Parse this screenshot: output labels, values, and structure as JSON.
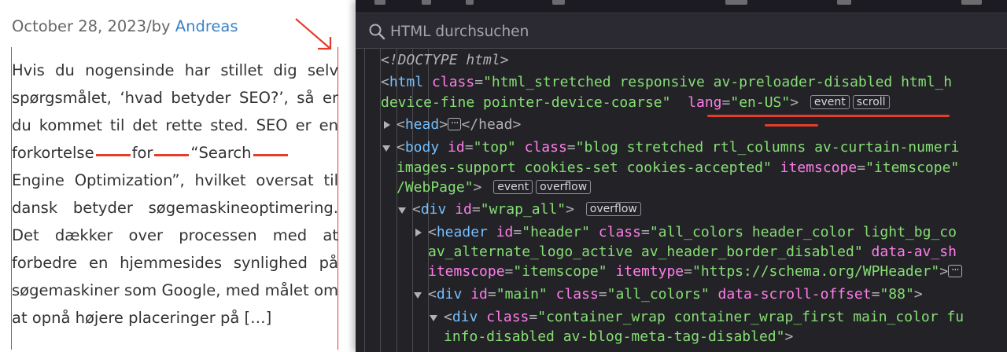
{
  "article": {
    "date": "October 28, 2023",
    "by": "/by ",
    "author": "Andreas",
    "paragraph": {
      "p1": "Hvis du nogensinde har stillet dig selv spørgsmålet, ‘hvad betyder SEO?’, så er du kommet til det rette sted. SEO er en forkortelse",
      "w1": "for",
      "w2": "“Search",
      "w3": "Engine Optimization”, hvilket oversat til dansk betyder søgemaskineoptimering. Det dækker over processen med at forbedre en hjemmesides synlighed på søgemaskiner som Google, med målet om at opnå højere placeringer på […]"
    }
  },
  "devtools": {
    "search": {
      "placeholder": "HTML durchsuchen"
    },
    "lines": {
      "doctype": "<!DOCTYPE html>",
      "html_tag": "html",
      "html_class_attr": "class",
      "html_class_val": "\"html_stretched responsive av-preloader-disabled html_h",
      "html_class_val2": "device-fine pointer-device-coarse\"",
      "html_lang_attr": "lang",
      "html_lang_val": "\"en-US\"",
      "head_tag": "head",
      "head_close": "</head>",
      "body_tag": "body",
      "body_id_attr": "id",
      "body_id_val": "\"top\"",
      "body_class_attr": "class",
      "body_class_val": "\"blog stretched rtl_columns av-curtain-numeri",
      "body_class_val2": "images-support cookies-set cookies-accepted\"",
      "body_itemscope_attr": "itemscope",
      "body_itemscope_val": "\"itemscope\"",
      "body_itemtype_tail": "/WebPage\"",
      "wrap_tag": "div",
      "wrap_id_attr": "id",
      "wrap_id_val": "\"wrap_all\"",
      "header_tag": "header",
      "header_id_attr": "id",
      "header_id_val": "\"header\"",
      "header_class_attr": "class",
      "header_class_val": "\"all_colors header_color light_bg_co",
      "header_class_val2": "av_alternate_logo_active av_header_border_disabled\"",
      "header_data_attr": "data-av_sh",
      "header_itemscope_attr": "itemscope",
      "header_itemscope_val": "\"itemscope\"",
      "header_itemtype_attr": "itemtype",
      "header_itemtype_val": "\"https://schema.org/WPHeader\"",
      "main_tag": "div",
      "main_id_attr": "id",
      "main_id_val": "\"main\"",
      "main_class_attr": "class",
      "main_class_val": "\"all_colors\"",
      "main_scroll_attr": "data-scroll-offset",
      "main_scroll_val": "\"88\"",
      "cont_tag": "div",
      "cont_class_attr": "class",
      "cont_class_val": "\"container_wrap container_wrap_first main_color fu",
      "cont_class_val2": "info-disabled av-blog-meta-tag-disabled\""
    },
    "badges": {
      "event": "event",
      "scroll": "scroll",
      "overflow": "overflow",
      "ellipsis": "···"
    }
  },
  "colors": {
    "annotation": "#e53d2a",
    "author_link": "#3b82c4",
    "devtools_bg": "#232327",
    "tag": "#75bfff",
    "attribute": "#ff7de9",
    "value": "#86de74"
  }
}
